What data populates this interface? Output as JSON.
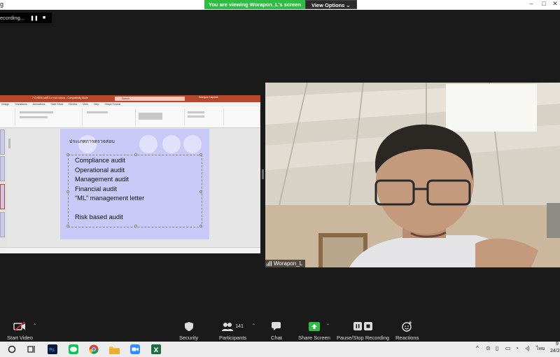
{
  "topbar": {
    "app_title": "g",
    "viewing_message": "You are viewing Worapon_L's screen",
    "view_options": "View Options ⌄"
  },
  "recording": {
    "label": "ecording...",
    "pause_icon": "pause-icon",
    "stop_icon": "stop-icon"
  },
  "shared_screen": {
    "app": "PowerPoint",
    "title_fragment": "7 CVERA บทที่ 3 การตรวจสอบ - Compatibility Mode",
    "search_placeholder": "Search",
    "user": "Worapon Lapmak",
    "ribbon_tabs": [
      "Design",
      "Transitions",
      "Animations",
      "Slide Show",
      "Review",
      "View",
      "Help",
      "Shape Format"
    ],
    "slide": {
      "title": "ประเภทการตรวจสอบ",
      "bullets": [
        "Compliance audit",
        "Operational audit",
        "Management audit",
        "Financial audit",
        "“ML” management letter",
        "",
        "Risk based audit"
      ]
    },
    "accent": "#b7472a"
  },
  "video": {
    "participant_name": "Worapon_L"
  },
  "toolbar": {
    "start_video": "Start Video",
    "security": "Security",
    "participants": "Participants",
    "participants_count": "141",
    "chat": "Chat",
    "share_screen": "Share Screen",
    "pause_stop_recording": "Pause/Stop Recording",
    "reactions": "Reactions",
    "share_color": "#2dbd43"
  },
  "taskbar": {
    "apps": [
      "start-icon",
      "task-view-icon",
      "photoshop-icon",
      "line-icon",
      "chrome-icon",
      "file-explorer-icon",
      "zoom-icon",
      "excel-icon"
    ],
    "language": "ไทย",
    "time": "9",
    "date": "24/2"
  }
}
